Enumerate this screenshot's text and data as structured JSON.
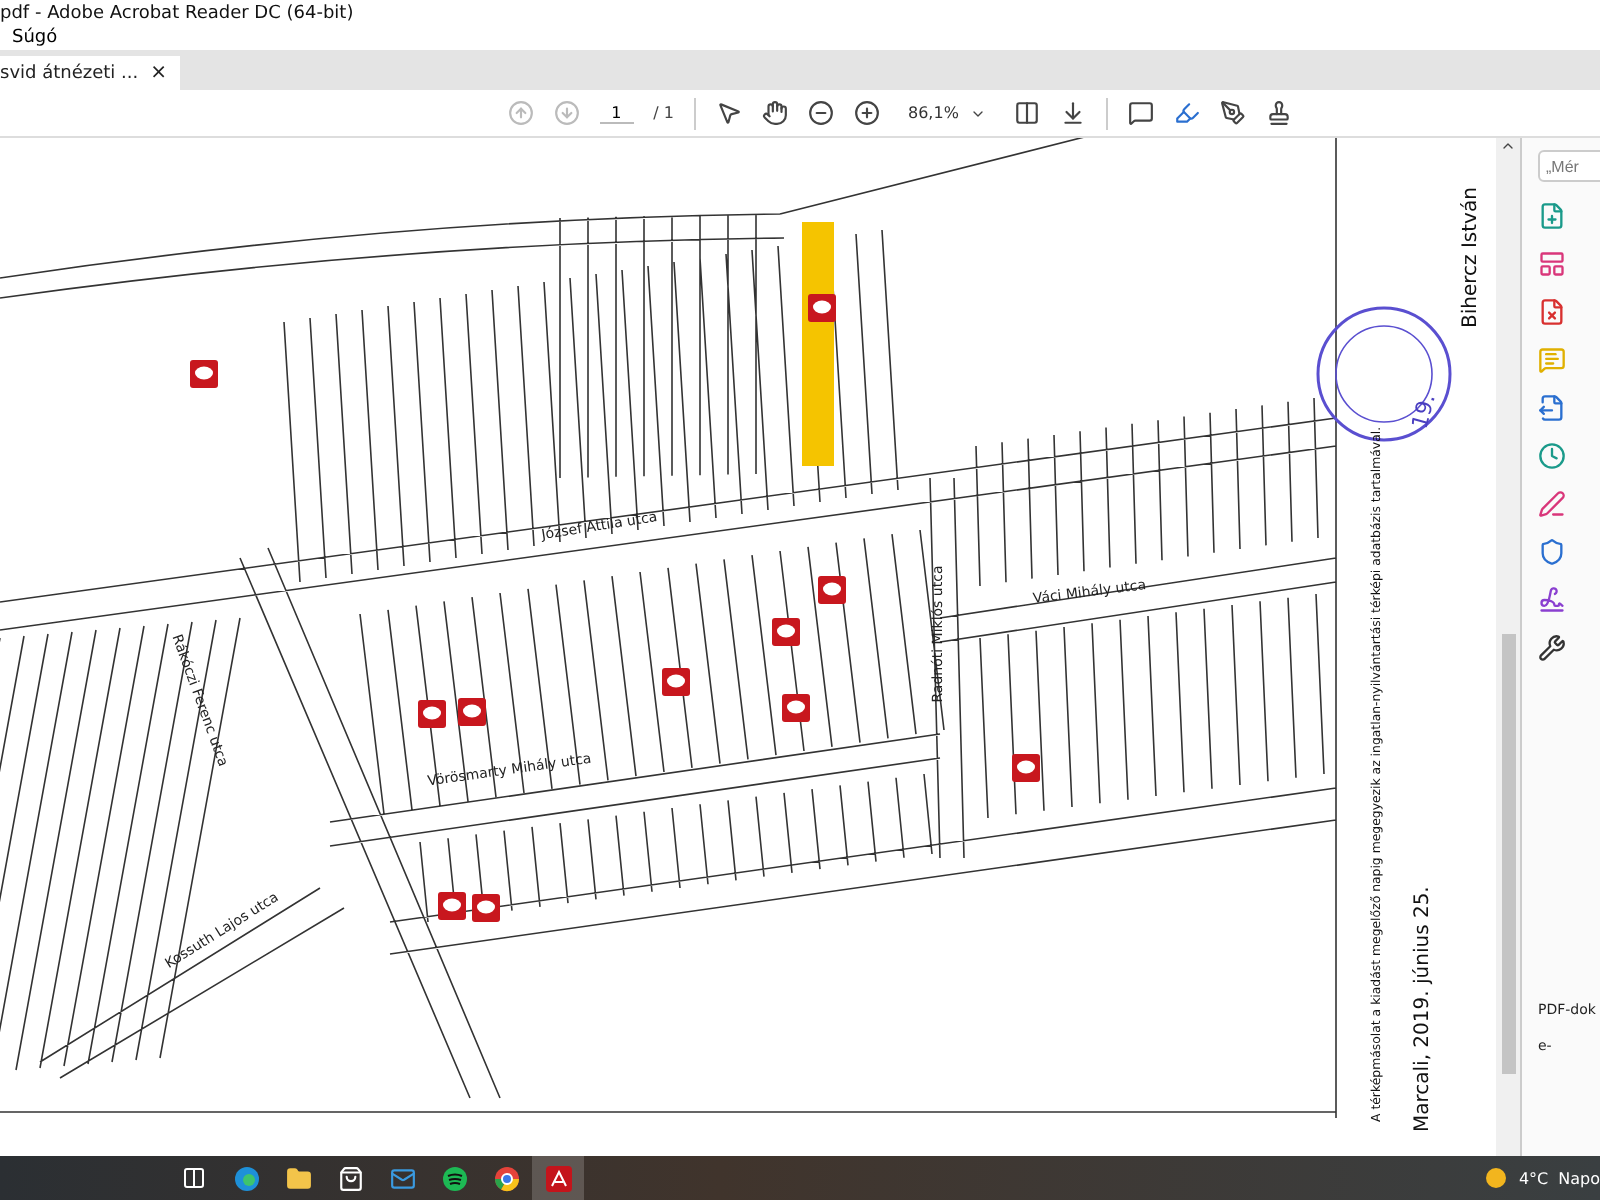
{
  "window": {
    "title": "pdf - Adobe Acrobat Reader DC (64-bit)"
  },
  "menu": [
    "Súgó"
  ],
  "tabs": [
    {
      "label": "svid átnézeti ...",
      "close": "×",
      "selected": true
    }
  ],
  "toolbar": {
    "page": "1",
    "page_total": "/ 1",
    "zoom": "86,1%"
  },
  "document": {
    "streets": [
      {
        "label": "József Attila utca"
      },
      {
        "label": "Váci Mihály utca"
      },
      {
        "label": "Vörösmarty Mihály utca"
      },
      {
        "label": "Kossuth Lajos utca"
      },
      {
        "label": "Radnóti Miklós utca"
      },
      {
        "label": "Rákóczi Ferenc utca"
      }
    ],
    "notes": [
      {
        "kind": "small",
        "text": "A térképmásolat a kiadást megelőző napig megegyezik az ingatlan-nyilvántartási térképi adatbázis tartalmával."
      },
      {
        "kind": "large",
        "text": "Marcali, 2019. június 25."
      }
    ],
    "stamp_number": "19.",
    "signature": "Bihercz István"
  },
  "right_panel": {
    "search": {
      "placeholder": "„Mér"
    },
    "footer": [
      "PDF-dok",
      "e-"
    ]
  },
  "taskbar": {
    "temperature": "4°C",
    "label": "Napo"
  }
}
